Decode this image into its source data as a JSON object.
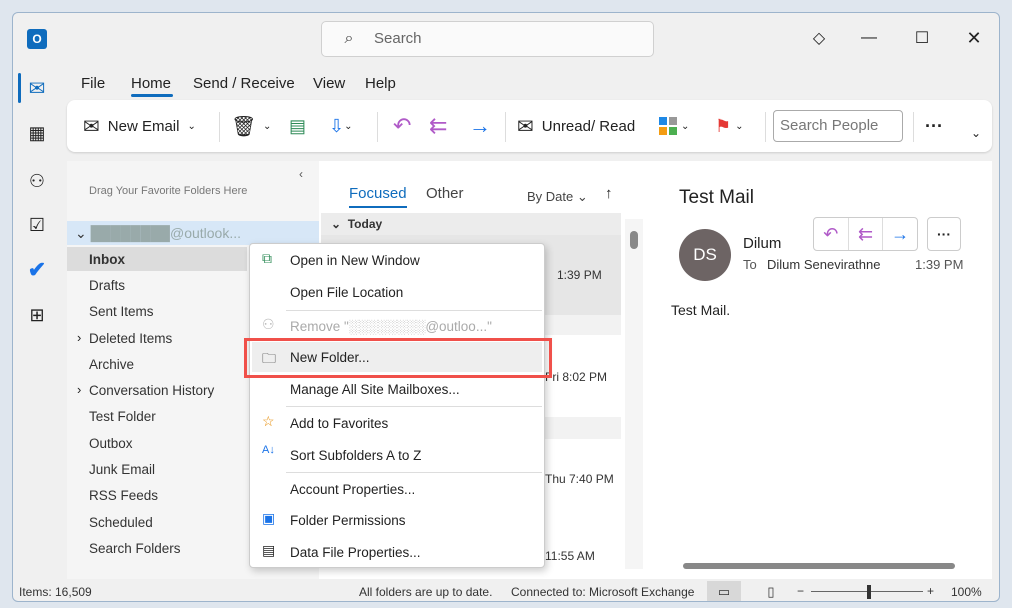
{
  "search": {
    "placeholder": "Search"
  },
  "menu_tabs": [
    "File",
    "Home",
    "Send / Receive",
    "View",
    "Help"
  ],
  "ribbon": {
    "new_email": "New Email",
    "unread_read": "Unread/ Read",
    "search_people": "Search People"
  },
  "folders": {
    "hint": "Drag Your Favorite Folders Here",
    "account": "████████@outlook...",
    "items": [
      "Inbox",
      "Drafts",
      "Sent Items",
      "Deleted Items",
      "Archive",
      "Conversation History",
      "Test Folder",
      "Outbox",
      "Junk Email",
      "RSS Feeds",
      "Scheduled",
      "Search Folders"
    ]
  },
  "list": {
    "tab_focused": "Focused",
    "tab_other": "Other",
    "sort": "By Date",
    "group_today": "Today",
    "times": [
      "1:39 PM",
      "Fri 8:02 PM",
      "Thu 7:40 PM",
      "11:55 AM"
    ]
  },
  "reading": {
    "subject": "Test Mail",
    "initials": "DS",
    "sender": "Dilum",
    "to_label": "To",
    "recipient": "Dilum Senevirathne",
    "time": "1:39 PM",
    "body": "Test Mail."
  },
  "context_menu": {
    "open_new_window": "Open in New Window",
    "open_file_location": "Open File Location",
    "remove": "Remove \"░░░░░░░░@outloo...\"",
    "new_folder": "New Folder...",
    "manage_mailboxes": "Manage All Site Mailboxes...",
    "add_favorites": "Add to Favorites",
    "sort_subfolders": "Sort Subfolders A to Z",
    "account_properties": "Account Properties...",
    "folder_permissions": "Folder Permissions",
    "data_file_properties": "Data File Properties..."
  },
  "status": {
    "items": "Items: 16,509",
    "sync": "All folders are up to date.",
    "connection": "Connected to: Microsoft Exchange",
    "zoom": "100%"
  },
  "colors": {
    "accent": "#0f6cbd",
    "highlight": "#f0504a"
  }
}
